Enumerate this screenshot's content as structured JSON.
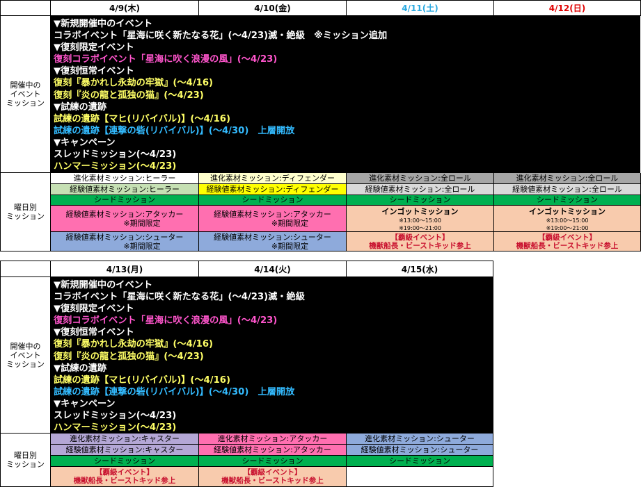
{
  "colors": {
    "saturday": "#29a9e0",
    "sunday": "#e00000",
    "event_white": "#ffffff",
    "event_pink": "#ff55cc",
    "event_yellow": "#ffff66",
    "event_cyan": "#33bbff",
    "healer": "#c6e0b4",
    "defender": "#ffff66",
    "all_role": "#a6a6a6",
    "all_role_light": "#d9d9d9",
    "seed": "#00b050",
    "attacker": "#ff6fb0",
    "shooter": "#8eaadb",
    "caster": "#b4a7d6",
    "peach": "#f8cbad"
  },
  "row_labels": {
    "events": [
      "開催中の",
      "イベント",
      "ミッション"
    ],
    "daily": [
      "曜日別",
      "ミッション"
    ]
  },
  "events": [
    "▼新規開催中のイベント",
    "コラボイベント「星海に咲く新たなる花」(～4/23)滅・絶級　※ミッション追加",
    "▼復刻限定イベント",
    "復刻コラボイベント「星海に吹く浪漫の風」(～4/23)",
    "▼復刻恒常イベント",
    "復刻『暴かれし永劫の牢獄』(～4/16)",
    "復刻『炎の龍と孤独の猫』(～4/23)",
    "▼試練の遺跡",
    "試練の遺跡【マヒ(リバイバル)】(～4/16)",
    "試練の遺跡【連撃の砦(リバイバル)】(～4/30)　上層開放",
    "▼キャンペーン",
    "スレッドミッション(～4/23)",
    "ハンマーミッション(～4/23)"
  ],
  "events2": [
    "▼新規開催中のイベント",
    "コラボイベント「星海に咲く新たなる花」(～4/23)滅・絶級",
    "▼復刻限定イベント",
    "復刻コラボイベント「星海に吹く浪漫の風」(～4/23)",
    "▼復刻恒常イベント",
    "復刻『暴かれし永劫の牢獄』(～4/16)",
    "復刻『炎の龍と孤独の猫』(～4/23)",
    "▼試練の遺跡",
    "試練の遺跡【マヒ(リバイバル)】(～4/16)",
    "試練の遺跡【連撃の砦(リバイバル)】(～4/30)　上層開放",
    "▼キャンペーン",
    "スレッドミッション(～4/23)",
    "ハンマーミッション(～4/23)"
  ],
  "week1": {
    "days": [
      "4/9(木)",
      "4/10(金)",
      "4/11(土)",
      "4/12(日)"
    ],
    "d1": {
      "evo": "進化素材ミッション:ヒーラー",
      "exp": "経験値素材ミッション:ヒーラー",
      "seed": "シードミッション",
      "m4a": "経験値素材ミッション:アタッカー",
      "m4b": "※期間限定",
      "m5a": "経験値素材ミッション:シューター",
      "m5b": "※期間限定"
    },
    "d2": {
      "evo": "進化素材ミッション:ディフェンダー",
      "exp": "経験値素材ミッション:ディフェンダー",
      "seed": "シードミッション",
      "m4a": "経験値素材ミッション:アタッカー",
      "m4b": "※期間限定",
      "m5a": "経験値素材ミッション:シューター",
      "m5b": "※期間限定"
    },
    "d3": {
      "evo": "進化素材ミッション:全ロール",
      "exp": "経験値素材ミッション:全ロール",
      "seed": "シードミッション",
      "ingot": "インゴットミッション",
      "t1": "※13:00～15:00",
      "t2": "※19:00～21:00",
      "ev1": "【覇級イベント】",
      "ev2": "機獣船長・ビーストキッド参上"
    },
    "d4": {
      "evo": "進化素材ミッション:全ロール",
      "exp": "経験値素材ミッション:全ロール",
      "seed": "シードミッション",
      "ingot": "インゴットミッション",
      "t1": "※13:00～15:00",
      "t2": "※19:00～21:00",
      "ev1": "【覇級イベント】",
      "ev2": "機獣船長・ビーストキッド参上"
    }
  },
  "week2": {
    "days": [
      "4/13(月)",
      "4/14(火)",
      "4/15(水)"
    ],
    "d1": {
      "evo": "進化素材ミッション:キャスター",
      "exp": "経験値素材ミッション:キャスター",
      "seed": "シードミッション",
      "ev1": "【覇級イベント】",
      "ev2": "機獣船長・ビーストキッド参上"
    },
    "d2": {
      "evo": "進化素材ミッション:アタッカー",
      "exp": "経験値素材ミッション:アタッカー",
      "seed": "シードミッション",
      "ev1": "【覇級イベント】",
      "ev2": "機獣船長・ビーストキッド参上"
    },
    "d3": {
      "evo": "進化素材ミッション:シューター",
      "exp": "経験値素材ミッション:シューター",
      "seed": "シードミッション"
    }
  }
}
